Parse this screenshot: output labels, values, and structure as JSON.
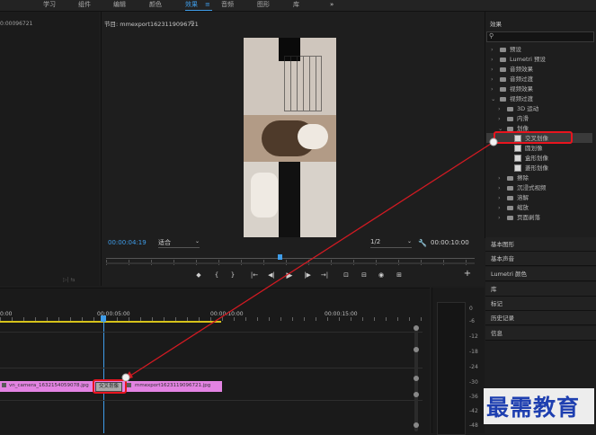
{
  "workspace_tabs": [
    "学习",
    "组件",
    "编辑",
    "颜色",
    "效果",
    "音频",
    "图形",
    "库"
  ],
  "active_tab_suffix": "≡",
  "overflow": "»",
  "source_timecode": "0:00096721",
  "program": {
    "title": "节目: mmexport1623119096721",
    "menu": "≡",
    "timecode_current": "00:00:04:19",
    "fit_label": "适合",
    "quality_label": "1/2",
    "timecode_duration": "00:00:10:00"
  },
  "controls": [
    "◆",
    "{",
    "}",
    "|←",
    "◀|",
    "▶",
    "|▶",
    "→|",
    "⊡",
    "⊟",
    "◉",
    "⊞",
    "+"
  ],
  "effects": {
    "title": "效果",
    "menu": "≡",
    "search_placeholder": "",
    "tree": [
      {
        "label": "预设",
        "level": 0,
        "kind": "folder",
        "arrow": "›"
      },
      {
        "label": "Lumetri 预设",
        "level": 0,
        "kind": "folder",
        "arrow": "›"
      },
      {
        "label": "音频效果",
        "level": 0,
        "kind": "folder",
        "arrow": "›"
      },
      {
        "label": "音频过渡",
        "level": 0,
        "kind": "folder",
        "arrow": "›"
      },
      {
        "label": "视频效果",
        "level": 0,
        "kind": "folder",
        "arrow": "›"
      },
      {
        "label": "视频过渡",
        "level": 0,
        "kind": "folder",
        "arrow": "⌄"
      },
      {
        "label": "3D 运动",
        "level": 1,
        "kind": "folder",
        "arrow": "›"
      },
      {
        "label": "内滑",
        "level": 1,
        "kind": "folder",
        "arrow": "›"
      },
      {
        "label": "划像",
        "level": 1,
        "kind": "folder",
        "arrow": "⌄"
      },
      {
        "label": "交叉划像",
        "level": 2,
        "kind": "item",
        "arrow": "",
        "selected": true
      },
      {
        "label": "圆划像",
        "level": 2,
        "kind": "item",
        "arrow": ""
      },
      {
        "label": "盒形划像",
        "level": 2,
        "kind": "item",
        "arrow": ""
      },
      {
        "label": "菱形划像",
        "level": 2,
        "kind": "item",
        "arrow": ""
      },
      {
        "label": "擦除",
        "level": 1,
        "kind": "folder",
        "arrow": "›"
      },
      {
        "label": "沉浸式视频",
        "level": 1,
        "kind": "folder",
        "arrow": "›"
      },
      {
        "label": "溶解",
        "level": 1,
        "kind": "folder",
        "arrow": "›"
      },
      {
        "label": "缩放",
        "level": 1,
        "kind": "folder",
        "arrow": "›"
      },
      {
        "label": "页面剥落",
        "level": 1,
        "kind": "folder",
        "arrow": "›"
      }
    ]
  },
  "side_panels": [
    "基本图形",
    "基本声音",
    "Lumetri 颜色",
    "库",
    "标记",
    "历史记录",
    "信息"
  ],
  "timeline": {
    "ruler": [
      "0:00",
      "00:00:05:00",
      "00:00:10:00",
      "00:00:15:00"
    ],
    "clip1": "vn_camera_1632154059078.jpg",
    "transition": "交叉划像",
    "clip2": "mmexport1623119096721.jpg"
  },
  "meter_scale": [
    "0",
    "-6",
    "-12",
    "-18",
    "-24",
    "-30",
    "-36",
    "-42",
    "-48"
  ],
  "watermark": "最需教育",
  "colors": {
    "accent": "#3f9de9",
    "highlight": "#e8141e",
    "clip": "#e383e2",
    "arrow": "#d21a22"
  }
}
